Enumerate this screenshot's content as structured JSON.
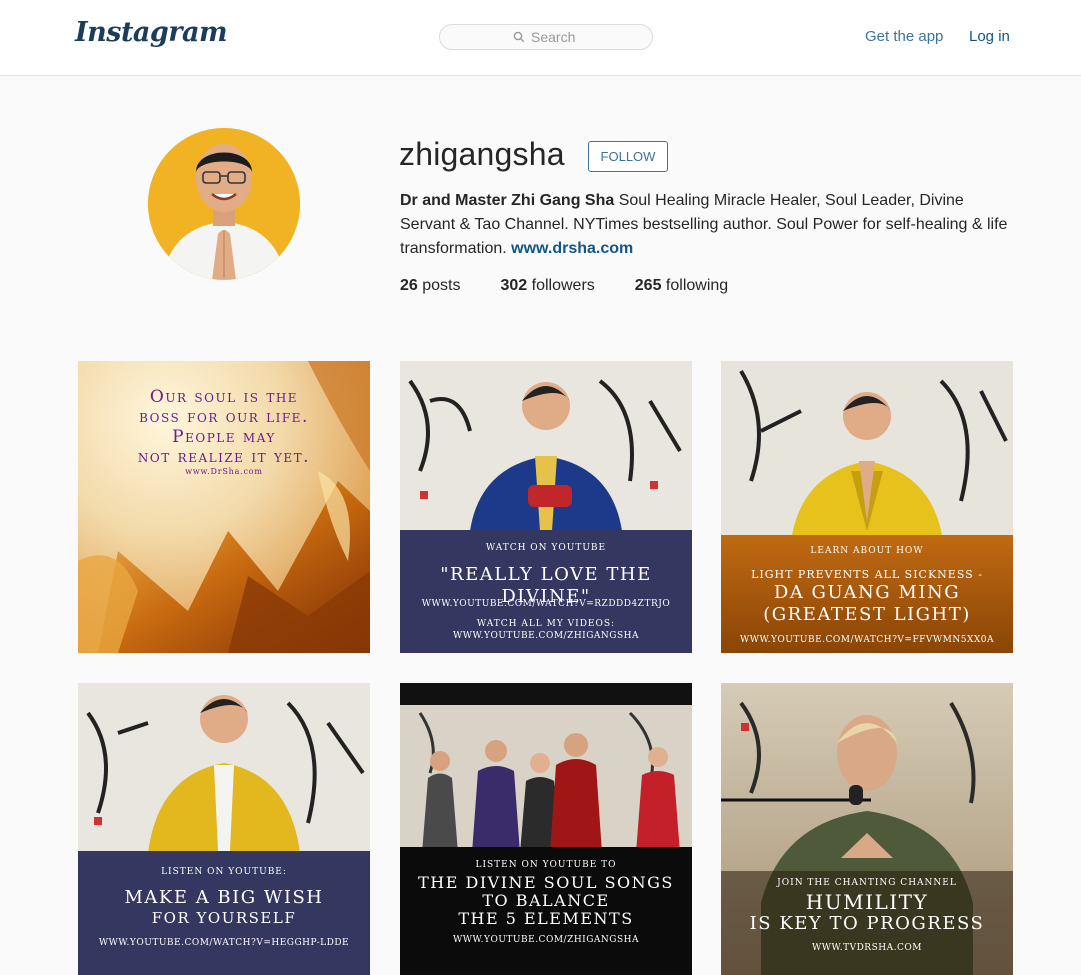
{
  "header": {
    "logo": "Instagram",
    "search_placeholder": "Search",
    "get_app": "Get the app",
    "login": "Log in"
  },
  "profile": {
    "username": "zhigangsha",
    "follow_label": "FOLLOW",
    "bio_name": "Dr and Master Zhi Gang Sha",
    "bio_text": " Soul Healing Miracle Healer, Soul Leader, Divine Servant & Tao Channel. NYTimes bestselling author. Soul Power for self-healing & life transformation. ",
    "bio_link": "www.drsha.com",
    "stats": {
      "posts_count": "26",
      "posts_label": " posts",
      "followers_count": "302",
      "followers_label": " followers",
      "following_count": "265",
      "following_label": " following"
    }
  },
  "posts": [
    {
      "line1": "Our soul is the",
      "line2": "boss for our life.",
      "line3": "People may",
      "line4": "not realize it yet.",
      "url": "www.DrSha.com"
    },
    {
      "small": "WATCH ON YOUTUBE",
      "big": "\"REALLY LOVE THE DIVINE\"",
      "url1": "WWW.YOUTUBE.COM/WATCH?V=RZDDD4ZTRJO",
      "small2": "WATCH ALL MY VIDEOS:",
      "url2": "WWW.YOUTUBE.COM/ZHIGANGSHA"
    },
    {
      "small": "LEARN ABOUT HOW",
      "small2": "LIGHT PREVENTS ALL SICKNESS -",
      "big1": "DA GUANG MING",
      "big2": "(GREATEST LIGHT)",
      "url": "WWW.YOUTUBE.COM/WATCH?V=FFVWMN5XX0A"
    },
    {
      "small": "LISTEN ON YOUTUBE:",
      "big1": "MAKE A BIG WISH",
      "big2": "FOR YOURSELF",
      "url": "WWW.YOUTUBE.COM/WATCH?V=HEGGHP-LDDE"
    },
    {
      "small": "LISTEN ON YOUTUBE TO",
      "big1": "THE DIVINE SOUL SONGS",
      "big2": "TO BALANCE",
      "big3": "THE 5 ELEMENTS",
      "url": "WWW.YOUTUBE.COM/ZHIGANGSHA"
    },
    {
      "small": "JOIN THE CHANTING CHANNEL",
      "big1": "HUMILITY",
      "big2": "IS KEY TO PROGRESS",
      "url": "WWW.TVDRSHA.COM"
    }
  ],
  "colors": {
    "link_blue": "#3f729b",
    "dark_link": "#125688",
    "navy_panel": "#343760",
    "avatar_bg": "#f1b323"
  }
}
